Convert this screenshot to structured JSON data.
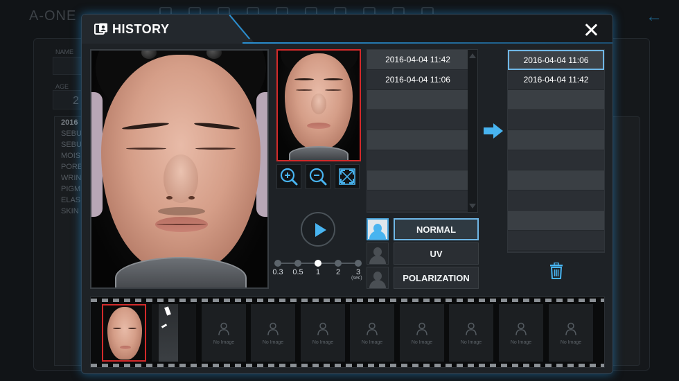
{
  "background_app": {
    "logo": "A-ONE",
    "name_label": "NAME",
    "age_label": "AGE",
    "age_value": "2",
    "list_header": "2016",
    "list_items": [
      "SEBU",
      "SEBU",
      "MOIS",
      "PORE",
      "WRIN",
      "PIGM",
      "ELAS",
      "SKIN"
    ]
  },
  "dialog": {
    "title": "HISTORY",
    "icon": "history-face-icon",
    "close_icon": "close-icon"
  },
  "date_list": {
    "rows": [
      "2016-04-04 11:42",
      "2016-04-04 11:06",
      "",
      "",
      "",
      "",
      "",
      ""
    ]
  },
  "selected_list": {
    "rows": [
      "2016-04-04 11:06",
      "2016-04-04 11:42",
      "",
      "",
      "",
      "",
      "",
      "",
      "",
      ""
    ],
    "selected_index": 0
  },
  "zoom_buttons": [
    "zoom-in-icon",
    "zoom-out-icon",
    "fit-screen-icon"
  ],
  "playback": {
    "speeds": [
      "0.3",
      "0.5",
      "1",
      "2",
      "3"
    ],
    "unit": "(sec)",
    "selected": "1"
  },
  "modes": [
    {
      "label": "NORMAL",
      "active": true
    },
    {
      "label": "UV",
      "active": false
    },
    {
      "label": "POLARIZATION",
      "active": false
    }
  ],
  "filmstrip": {
    "placeholder_label": "No Image",
    "placeholder_count": 8
  },
  "colors": {
    "accent": "#48b4f0",
    "selection_red": "#d42a2a",
    "panel": "#1e2226"
  }
}
